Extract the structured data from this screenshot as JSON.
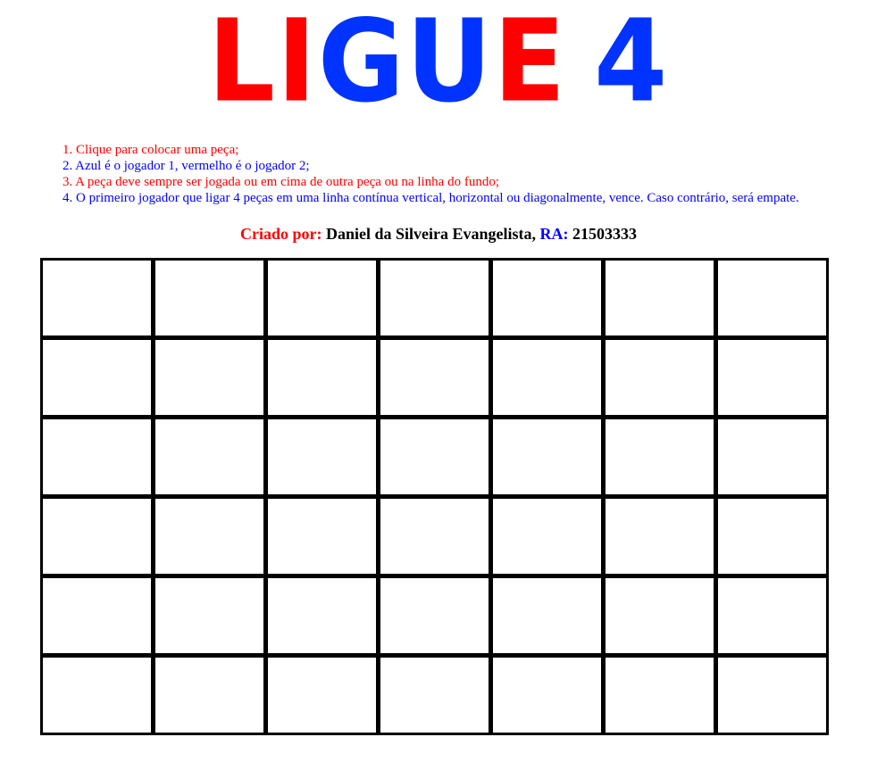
{
  "title": {
    "letters": [
      {
        "char": "L",
        "color": "#ff0000"
      },
      {
        "char": "I",
        "color": "#ff0000"
      },
      {
        "char": "G",
        "color": "#0033ff"
      },
      {
        "char": "U",
        "color": "#0033ff"
      },
      {
        "char": "E",
        "color": "#ff0000"
      },
      {
        "char": " ",
        "color": "#ff0000"
      },
      {
        "char": "4",
        "color": "#0033ff"
      }
    ]
  },
  "colors": {
    "red": "#ff0000",
    "blue": "#0000ff",
    "board_lines": "#000000",
    "cell": "#ffffff"
  },
  "rules": [
    {
      "text": "1. Clique para colocar uma peça;",
      "color": "#ff0000"
    },
    {
      "text": "2. Azul é o jogador 1, vermelho é o jogador 2;",
      "color": "#0000ff"
    },
    {
      "text": "3. A peça deve sempre ser jogada ou em cima de outra peça ou na linha do fundo;",
      "color": "#ff0000"
    },
    {
      "text": "4. O primeiro jogador que ligar 4 peças em uma linha contínua vertical, horizontal ou diagonalmente, vence. Caso contrário, será empate.",
      "color": "#0000ff"
    }
  ],
  "credits": {
    "created_by_label": "Criado por:",
    "author": "Daniel da Silveira Evangelista,",
    "ra_label": "RA:",
    "ra_value": "21503333"
  },
  "board": {
    "rows": 6,
    "columns": 7,
    "cells": [
      [
        "",
        "",
        "",
        "",
        "",
        "",
        ""
      ],
      [
        "",
        "",
        "",
        "",
        "",
        "",
        ""
      ],
      [
        "",
        "",
        "",
        "",
        "",
        "",
        ""
      ],
      [
        "",
        "",
        "",
        "",
        "",
        "",
        ""
      ],
      [
        "",
        "",
        "",
        "",
        "",
        "",
        ""
      ],
      [
        "",
        "",
        "",
        "",
        "",
        "",
        ""
      ]
    ]
  }
}
